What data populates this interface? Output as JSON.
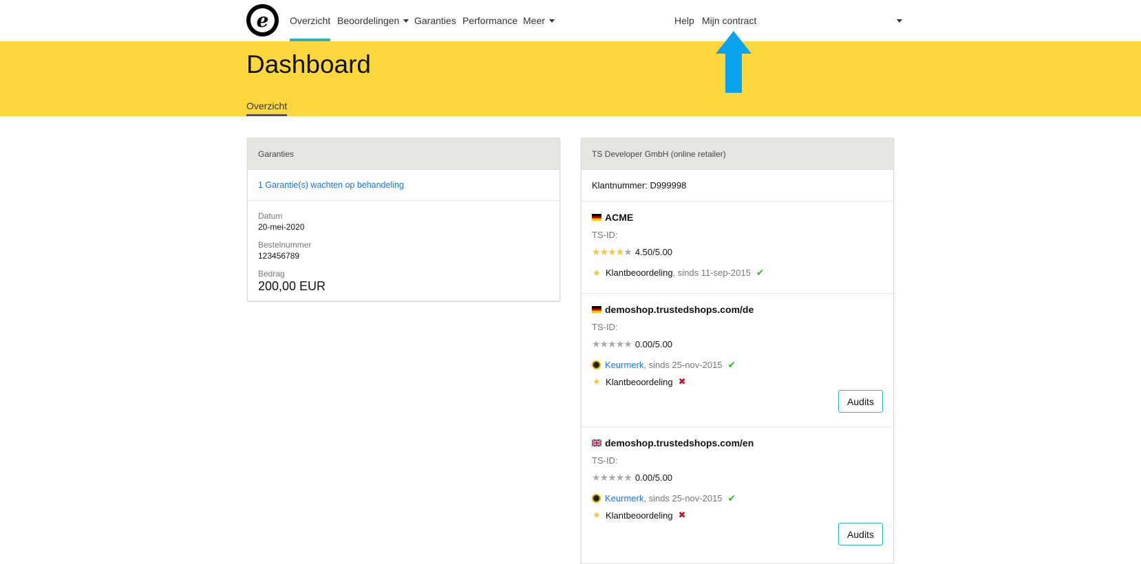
{
  "nav": {
    "logo": "e",
    "items": [
      {
        "label": "Overzicht",
        "active": true
      },
      {
        "label": "Beoordelingen",
        "dropdown": true
      },
      {
        "label": "Garanties"
      },
      {
        "label": "Performance"
      },
      {
        "label": "Meer",
        "dropdown": true
      }
    ],
    "help": "Help",
    "contract": "Mijn contract"
  },
  "header": {
    "title": "Dashboard",
    "subtab": "Overzicht"
  },
  "guarantees": {
    "title": "Garanties",
    "pending_link": "1 Garantie(s) wachten op behandeling",
    "date_label": "Datum",
    "date_value": "20-mei-2020",
    "order_label": "Bestelnummer",
    "order_value": "123456789",
    "amount_label": "Bedrag",
    "amount_value": "200,00 EUR"
  },
  "account": {
    "title": "TS Developer GmbH (online retailer)",
    "customer_number": "Klantnummer: D999998",
    "shops": [
      {
        "flag": "de",
        "name": "ACME",
        "tsid": "TS-ID:",
        "rating": 4.5,
        "rating_text": "4.50/5.00",
        "review_label": "Klantbeoordeling",
        "review_since": ", sinds 11-sep-2015"
      },
      {
        "flag": "de",
        "name": "demoshop.trustedshops.com/de",
        "tsid": "TS-ID:",
        "rating": 0,
        "rating_text": "0.00/5.00",
        "trustmark_label": "Keurmerk",
        "trustmark_since": ", sinds 25-nov-2015",
        "review_label": "Klantbeoordeling",
        "audits_label": "Audits"
      },
      {
        "flag": "uk",
        "name": "demoshop.trustedshops.com/en",
        "tsid": "TS-ID:",
        "rating": 0,
        "rating_text": "0.00/5.00",
        "trustmark_label": "Keurmerk",
        "trustmark_since": ", sinds 25-nov-2015",
        "review_label": "Klantbeoordeling",
        "audits_label": "Audits"
      }
    ]
  },
  "colors": {
    "header_yellow": "#fdd73e",
    "nav_active": "#2bb0c8",
    "annotation_arrow": "#0aa3ee",
    "link_blue": "#1a73e8"
  }
}
